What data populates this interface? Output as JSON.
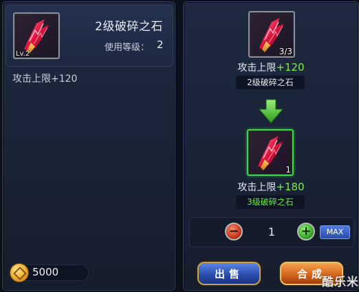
{
  "left_panel": {
    "item_level_badge": "Lv.2",
    "item_name": "2级破碎之石",
    "use_level_label": "使用等级：",
    "use_level_value": "2",
    "attribute": "攻击上限+120",
    "gold_amount": "5000",
    "gold_icon": "gold-coin-icon"
  },
  "right_panel": {
    "source": {
      "count": "3/3",
      "attribute_label": "攻击上限",
      "attribute_value": "+120",
      "name": "2级破碎之石"
    },
    "arrow_icon": "down-arrow-icon",
    "result": {
      "count": "1",
      "attribute_label": "攻击上限",
      "attribute_value": "+180",
      "name": "3级破碎之石"
    },
    "quantity": {
      "minus_icon": "minus-icon",
      "value": "1",
      "plus_icon": "plus-icon",
      "max_label": "MAX"
    },
    "sell_label": "出售",
    "combine_label": "合成"
  },
  "watermark": "酷乐米",
  "colors": {
    "accent_green": "#7df04a",
    "result_border": "#3fd64a",
    "sell_button": "#2849a8",
    "combine_button": "#d2621c"
  }
}
